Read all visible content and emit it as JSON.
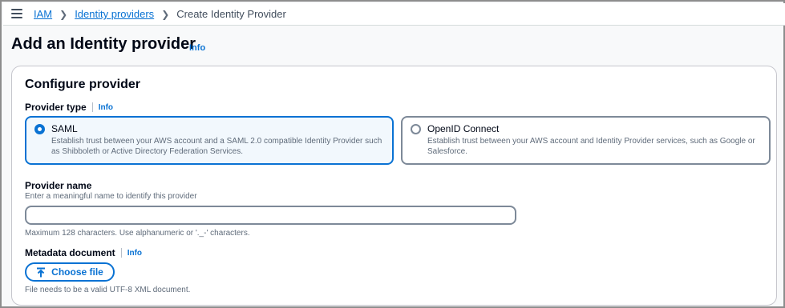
{
  "breadcrumb": {
    "items": [
      {
        "label": "IAM"
      },
      {
        "label": "Identity providers"
      }
    ],
    "current": "Create Identity Provider"
  },
  "page": {
    "title": "Add an Identity provider",
    "info_label": "Info"
  },
  "configure": {
    "title": "Configure provider",
    "provider_type": {
      "label": "Provider type",
      "info_label": "Info",
      "options": [
        {
          "title": "SAML",
          "description": "Establish trust between your AWS account and a SAML 2.0 compatible Identity Provider such as Shibboleth or Active Directory Federation Services.",
          "selected": true
        },
        {
          "title": "OpenID Connect",
          "description": "Establish trust between your AWS account and Identity Provider services, such as Google or Salesforce.",
          "selected": false
        }
      ]
    },
    "provider_name": {
      "label": "Provider name",
      "description": "Enter a meaningful name to identify this provider",
      "value": "",
      "constraint": "Maximum 128 characters. Use alphanumeric or '._-' characters."
    },
    "metadata": {
      "label": "Metadata document",
      "info_label": "Info",
      "button_label": "Choose file",
      "constraint": "File needs to be a valid UTF-8 XML document."
    }
  },
  "colors": {
    "accent": "#0972d3",
    "selected_bg": "#f2f8fd",
    "text_primary": "#000716",
    "text_secondary": "#5f6b7a"
  }
}
